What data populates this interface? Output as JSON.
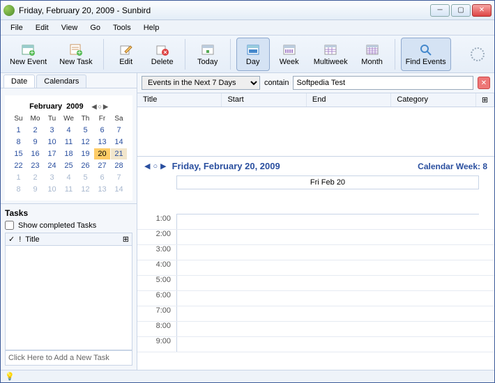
{
  "window": {
    "title": "Friday, February 20, 2009 - Sunbird"
  },
  "menubar": [
    "File",
    "Edit",
    "View",
    "Go",
    "Tools",
    "Help"
  ],
  "toolbar": {
    "newEvent": "New Event",
    "newTask": "New Task",
    "edit": "Edit",
    "delete": "Delete",
    "today": "Today",
    "day": "Day",
    "week": "Week",
    "multiweek": "Multiweek",
    "month": "Month",
    "findEvents": "Find Events"
  },
  "sidebar": {
    "tabs": {
      "date": "Date",
      "calendars": "Calendars"
    },
    "miniCal": {
      "month": "February",
      "year": "2009",
      "dow": [
        "Su",
        "Mo",
        "Tu",
        "We",
        "Th",
        "Fr",
        "Sa"
      ],
      "weeks": [
        [
          1,
          2,
          3,
          4,
          5,
          6,
          7
        ],
        [
          8,
          9,
          10,
          11,
          12,
          13,
          14
        ],
        [
          15,
          16,
          17,
          18,
          19,
          20,
          21
        ],
        [
          22,
          23,
          24,
          25,
          26,
          27,
          28
        ],
        [
          1,
          2,
          3,
          4,
          5,
          6,
          7
        ],
        [
          8,
          9,
          10,
          11,
          12,
          13,
          14
        ]
      ],
      "today": 20,
      "beside": 21,
      "dimFromRow": 4
    },
    "tasks": {
      "title": "Tasks",
      "showCompleted": "Show completed Tasks",
      "cols": {
        "check": "✓",
        "bang": "!",
        "title": "Title"
      },
      "addHint": "Click Here to Add a New Task"
    }
  },
  "search": {
    "rangeOptions": [
      "Events in the Next 7 Days"
    ],
    "rangeSelected": "Events in the Next 7 Days",
    "containLabel": "contain",
    "query": "Softpedia Test"
  },
  "listCols": {
    "title": "Title",
    "start": "Start",
    "end": "End",
    "category": "Category"
  },
  "dayview": {
    "date": "Friday, February 20, 2009",
    "weekLabel": "Calendar Week: 8",
    "dayLabel": "Fri Feb 20",
    "hours": [
      "1:00",
      "2:00",
      "3:00",
      "4:00",
      "5:00",
      "6:00",
      "7:00",
      "8:00",
      "9:00"
    ]
  }
}
